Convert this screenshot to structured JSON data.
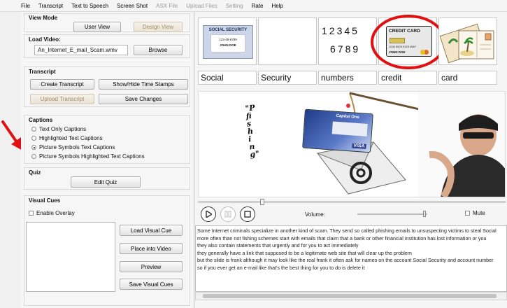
{
  "menu": [
    "File",
    "Transcript",
    "Text to Speech",
    "Screen Shot",
    "ASX File",
    "Upload Files",
    "Setting",
    "Rate",
    "Help"
  ],
  "menu_disabled": [
    false,
    false,
    false,
    false,
    true,
    true,
    true,
    false,
    false
  ],
  "view_mode": {
    "title": "View Mode",
    "user_view": "User View",
    "design_view": "Design View"
  },
  "load_video": {
    "title": "Load Video:",
    "filename": "An_Internet_E_mail_Scam.wmv",
    "browse": "Browse"
  },
  "transcript_section": {
    "title": "Transcript",
    "create": "Create Transcript",
    "show_hide": "Show/Hide Time Stamps",
    "upload": "Upload Transcript",
    "save": "Save Changes"
  },
  "captions": {
    "title": "Captions",
    "options": [
      "Text Only Captions",
      "Highlighted Text Captions",
      "Picture Symbols Text Captions",
      "Picture Symbols Highlighted Text Captions"
    ],
    "selected": 2
  },
  "quiz": {
    "title": "Quiz",
    "edit": "Edit Quiz"
  },
  "visual_cues": {
    "title": "Visual Cues",
    "enable_overlay": "Enable Overlay",
    "load": "Load Visual Cue",
    "place": "Place into Video",
    "preview": "Preview",
    "save": "Save Visual Cues"
  },
  "symbols": {
    "ss_card_title": "SOCIAL SECURITY",
    "ss_card_number": "123-45-6789",
    "ss_card_name": "JOHN DOE",
    "number_rows": [
      "12345",
      "6789"
    ],
    "credit_title": "CREDIT CARD",
    "credit_number": "1234 5678 9123 4567",
    "credit_name": "JOHN DOE"
  },
  "words": [
    "Social",
    "Security",
    "numbers",
    "credit",
    "card"
  ],
  "video": {
    "vertical_text": "\"Pfishing\"",
    "card_brand": "Capital One",
    "card_visa": "VISA"
  },
  "player": {
    "volume_label": "Volume:",
    "volume_level": 0.96,
    "mute_label": "Mute",
    "seek_position": 0.21
  },
  "transcript_lines": [
    "Some Internet criminals specialize in another kind of scam. They send so called phishing emails to unsuspecting victims to steal Social",
    "more often than not fishing schemes start with emails that claim that a bank or other financial institution has lost information or you",
    "they also contain statements that urgently and for you to act immediately",
    "they generally have a link that supposed to be a legitimate web site that will clear up the problem",
    "but the slide is frank although it may look like the real frank it often ask for names on the account Social Security and account number",
    "so if you ever get an e-mail like that's the best thing for you to do is delete it"
  ]
}
